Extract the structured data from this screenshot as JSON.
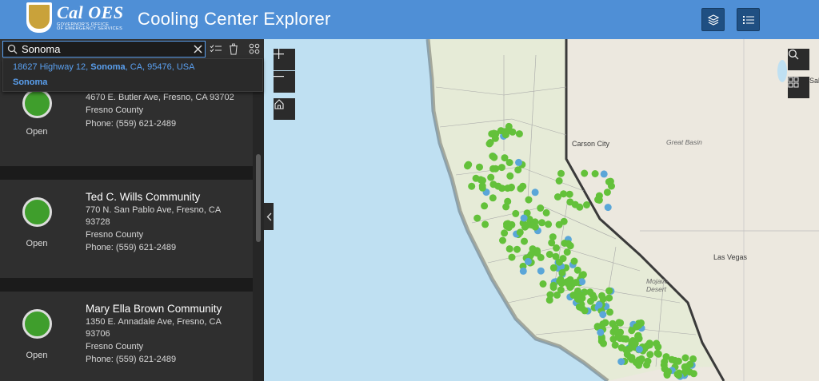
{
  "header": {
    "logo_main": "Cal OES",
    "logo_sub_1": "GOVERNOR'S OFFICE",
    "logo_sub_2": "OF EMERGENCY SERVICES",
    "title": "Cooling Center Explorer"
  },
  "search": {
    "value": "Sonoma",
    "suggestions": [
      {
        "prefix": "18627 Highway 12, ",
        "match": "Sonoma",
        "suffix": ", CA, 95476, USA"
      },
      {
        "prefix": "",
        "match": "Sonoma",
        "suffix": ""
      }
    ]
  },
  "centers": [
    {
      "name": "",
      "address": "4670 E. Butler Ave, Fresno, CA 93702",
      "address2": "",
      "county": "Fresno County",
      "phone": "Phone: (559) 621-2489",
      "status": "Open"
    },
    {
      "name": "Ted C. Wills Community",
      "address": "770 N. San Pablo Ave, Fresno, CA",
      "address2": "93728",
      "county": "Fresno County",
      "phone": "Phone: (559) 621-2489",
      "status": "Open"
    },
    {
      "name": "Mary Ella Brown Community",
      "address": "1350 E. Annadale Ave, Fresno, CA",
      "address2": "93706",
      "county": "Fresno County",
      "phone": "Phone: (559) 621-2489",
      "status": "Open"
    }
  ],
  "map": {
    "cities": [
      "Carson City",
      "Las Vegas"
    ],
    "terrain": [
      "Great Basin",
      "Mojave",
      "Desert"
    ],
    "edge_labels": [
      "Sal"
    ]
  },
  "colors": {
    "header": "#4f8fd6",
    "open_status": "#3f9e2c",
    "point_green": "#63c13a",
    "point_blue": "#5aa6d8"
  }
}
